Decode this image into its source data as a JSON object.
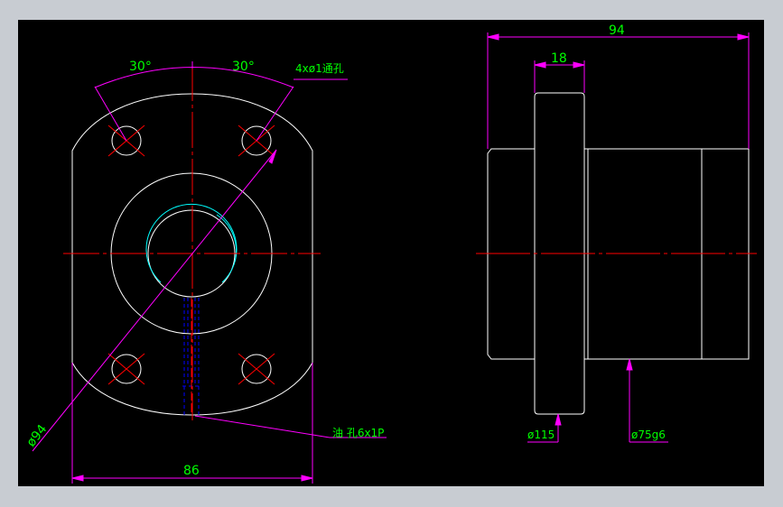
{
  "colors": {
    "background": "#000000",
    "frame": "#c8ccd2",
    "outline": "#ffffff",
    "centerline": "#ff0000",
    "dimension": "#ff00ff",
    "dimension_text": "#00ff00",
    "hidden": "#0000ff",
    "thread": "#00ffff"
  },
  "front_view": {
    "angle_left": "30°",
    "angle_right": "30°",
    "hole_note": "4xø1通孔",
    "diameter_bolt_circle": "ø94",
    "width": "86",
    "oil_hole_note": "油 孔6x1P"
  },
  "side_view": {
    "total_length": "94",
    "flange_thickness": "18",
    "flange_diameter": "ø115",
    "body_diameter": "ø75g6"
  }
}
